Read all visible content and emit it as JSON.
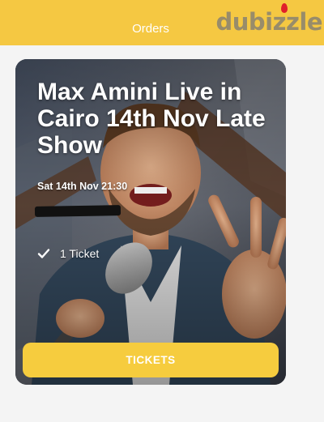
{
  "header": {
    "title": "Orders",
    "watermark": "dubizzle",
    "bar_color": "#f5c842"
  },
  "event": {
    "title": "Max Amini Live in Cairo 14th Nov Late Show",
    "datetime": "Sat 14th Nov 21:30",
    "ticket_icon": "check-icon",
    "ticket_count": "1 Ticket"
  },
  "actions": {
    "tickets_label": "TICKETS",
    "button_color": "#f6cc3e"
  }
}
